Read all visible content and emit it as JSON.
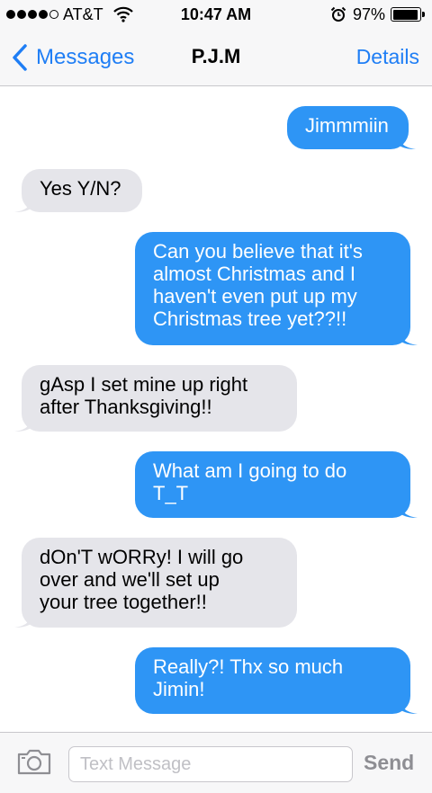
{
  "status_bar": {
    "carrier": "AT&T",
    "time": "10:47 AM",
    "battery_percent": "97%",
    "battery_level": 0.97,
    "signal_bars_filled": 4,
    "signal_bars_total": 5
  },
  "nav": {
    "back_label": "Messages",
    "title": "P.J.M",
    "details_label": "Details"
  },
  "messages": [
    {
      "direction": "outgoing",
      "text": "Jimmmiin"
    },
    {
      "direction": "incoming",
      "text": "Yes Y/N?"
    },
    {
      "direction": "outgoing",
      "text": "Can you believe that it's\nalmost Christmas and I\nhaven't even put up my\nChristmas tree yet??!!"
    },
    {
      "direction": "incoming",
      "text": "gAsp I set mine up right\nafter Thanksgiving!!"
    },
    {
      "direction": "outgoing",
      "text": "What am I going to do\nT_T"
    },
    {
      "direction": "incoming",
      "text": "dOn'T wORRy! I will go\nover and we'll set up\nyour tree together!!"
    },
    {
      "direction": "outgoing",
      "text": "Really?! Thx so much\nJimin!"
    }
  ],
  "input": {
    "placeholder": "Text Message",
    "send_label": "Send"
  },
  "colors": {
    "accent": "#1f7ef5",
    "outgoing_bubble": "#2e95f5",
    "incoming_bubble": "#e5e5ea",
    "send_disabled": "#8e8e93"
  },
  "icons": [
    "signal-dots-icon",
    "wifi-icon",
    "alarm-clock-icon",
    "battery-icon",
    "back-chevron-icon",
    "camera-icon"
  ]
}
